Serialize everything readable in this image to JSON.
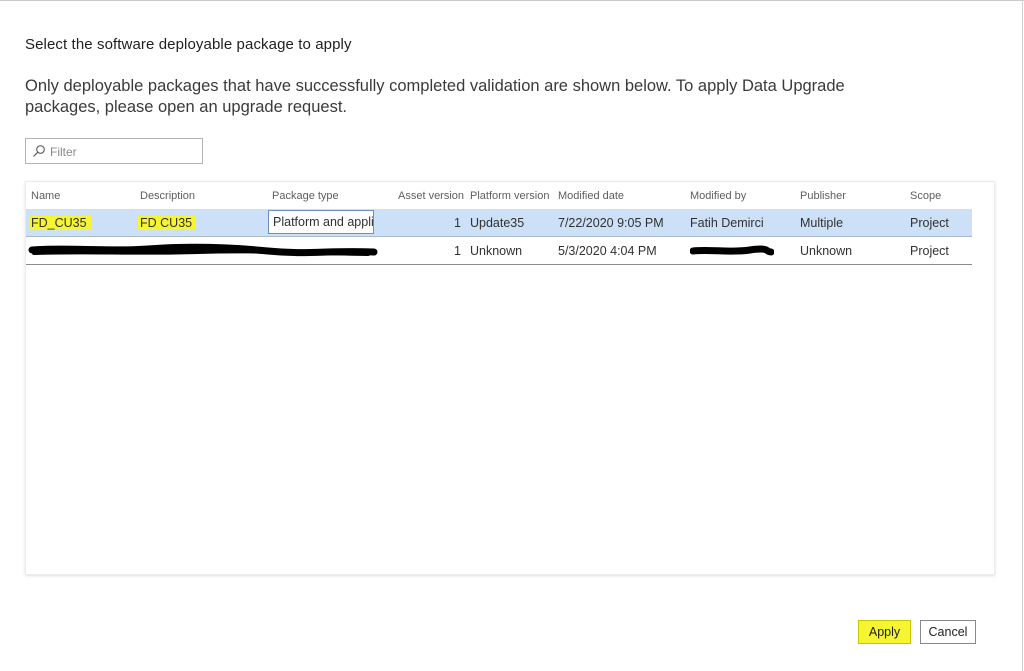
{
  "dialog": {
    "title": "Select the software deployable package to apply",
    "description": "Only deployable packages that have successfully completed validation are shown below. To apply Data Upgrade packages, please open an upgrade request."
  },
  "filter": {
    "placeholder": "Filter",
    "value": "",
    "icon": "search-icon"
  },
  "grid": {
    "columns": [
      "Name",
      "Description",
      "Package type",
      "Asset version",
      "Platform version",
      "Modified date",
      "Modified by",
      "Publisher",
      "Scope"
    ],
    "rows": [
      {
        "name": "FD_CU35",
        "description": "FD CU35",
        "package_type": "Platform and appli",
        "asset_version": "1",
        "platform_version": "Update35",
        "modified_date": "7/22/2020 9:05 PM",
        "modified_by": "Fatih Demirci",
        "publisher": "Multiple",
        "scope": "Project",
        "selected": true
      },
      {
        "name": "",
        "description": "",
        "package_type": "",
        "asset_version": "1",
        "platform_version": "Unknown",
        "modified_date": "5/3/2020 4:04 PM",
        "modified_by": "",
        "publisher": "Unknown",
        "scope": "Project",
        "redacted": true
      }
    ]
  },
  "buttons": {
    "apply": "Apply",
    "cancel": "Cancel"
  },
  "colors": {
    "selected_row": "#cce0f7",
    "highlight": "#f5f532",
    "redaction": "#000000"
  }
}
